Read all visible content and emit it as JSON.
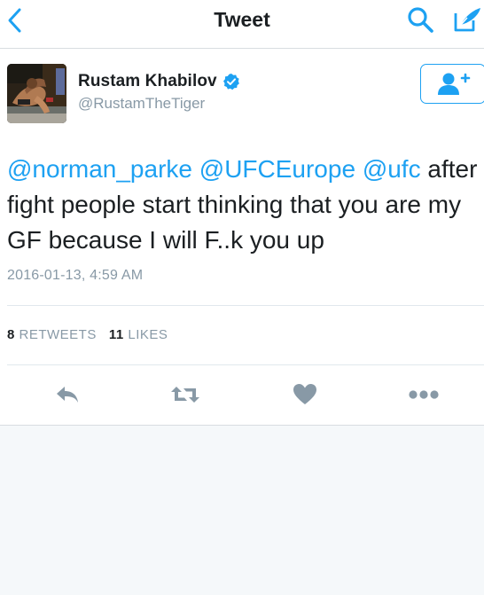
{
  "nav": {
    "title": "Tweet",
    "back_icon": "chevron-left-icon",
    "search_icon": "search-icon",
    "compose_icon": "compose-icon"
  },
  "tweet": {
    "author": {
      "display_name": "Rustam Khabilov",
      "handle": "@RustamTheTiger",
      "verified": true
    },
    "text_parts": [
      {
        "type": "mention",
        "text": "@norman_parke"
      },
      {
        "type": "text",
        "text": " "
      },
      {
        "type": "mention",
        "text": "@UFCEurope"
      },
      {
        "type": "text",
        "text": " "
      },
      {
        "type": "mention",
        "text": "@ufc"
      },
      {
        "type": "text",
        "text": " after fight people start thinking that you are my GF because I will F..k you up"
      }
    ],
    "timestamp": "2016-01-13, 4:59 AM",
    "stats": {
      "retweets_count": "8",
      "retweets_label": "RETWEETS",
      "likes_count": "11",
      "likes_label": "LIKES"
    }
  },
  "actions": [
    "reply-icon",
    "retweet-icon",
    "like-icon",
    "more-icon"
  ],
  "colors": {
    "accent": "#1da1f2",
    "action_gray": "#8899a6",
    "text": "#1b1f22",
    "muted": "#8899a6",
    "page_bg": "#f5f8fa"
  }
}
